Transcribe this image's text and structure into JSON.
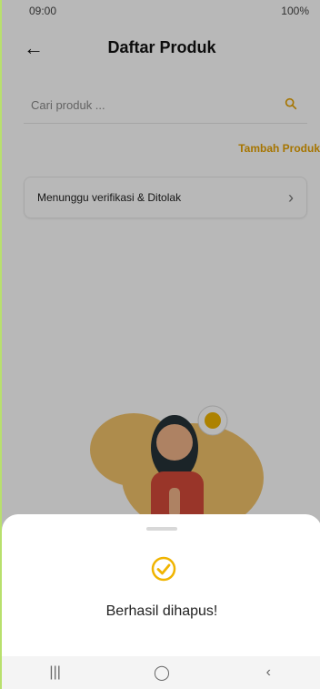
{
  "statusbar": {
    "time": "09:00",
    "right": "100%"
  },
  "header": {
    "title": "Daftar Produk"
  },
  "search": {
    "placeholder": "Cari produk ..."
  },
  "actions": {
    "add_product": "Tambah Produk"
  },
  "cards": [
    {
      "label": "Menunggu verifikasi & Ditolak"
    }
  ],
  "bottom_sheet": {
    "message": "Berhasil dihapus!"
  },
  "colors": {
    "accent": "#e7a200",
    "success": "#f0b400",
    "overlay": "#000000"
  },
  "icons": {
    "back": "arrow-left-icon",
    "search": "search-icon",
    "chevron": "chevron-right-icon",
    "success": "check-circle-icon",
    "recent_apps": "recent-apps-icon",
    "home": "home-icon",
    "back_nav": "back-nav-icon"
  }
}
